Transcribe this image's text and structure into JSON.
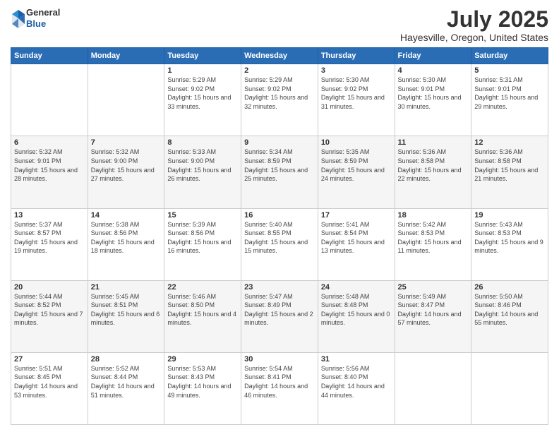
{
  "header": {
    "logo": {
      "line1": "General",
      "line2": "Blue"
    },
    "title": "July 2025",
    "location": "Hayesville, Oregon, United States"
  },
  "days_of_week": [
    "Sunday",
    "Monday",
    "Tuesday",
    "Wednesday",
    "Thursday",
    "Friday",
    "Saturday"
  ],
  "weeks": [
    [
      {
        "day": "",
        "data": ""
      },
      {
        "day": "",
        "data": ""
      },
      {
        "day": "1",
        "sunrise": "5:29 AM",
        "sunset": "9:02 PM",
        "daylight": "15 hours and 33 minutes."
      },
      {
        "day": "2",
        "sunrise": "5:29 AM",
        "sunset": "9:02 PM",
        "daylight": "15 hours and 32 minutes."
      },
      {
        "day": "3",
        "sunrise": "5:30 AM",
        "sunset": "9:02 PM",
        "daylight": "15 hours and 31 minutes."
      },
      {
        "day": "4",
        "sunrise": "5:30 AM",
        "sunset": "9:01 PM",
        "daylight": "15 hours and 30 minutes."
      },
      {
        "day": "5",
        "sunrise": "5:31 AM",
        "sunset": "9:01 PM",
        "daylight": "15 hours and 29 minutes."
      }
    ],
    [
      {
        "day": "6",
        "sunrise": "5:32 AM",
        "sunset": "9:01 PM",
        "daylight": "15 hours and 28 minutes."
      },
      {
        "day": "7",
        "sunrise": "5:32 AM",
        "sunset": "9:00 PM",
        "daylight": "15 hours and 27 minutes."
      },
      {
        "day": "8",
        "sunrise": "5:33 AM",
        "sunset": "9:00 PM",
        "daylight": "15 hours and 26 minutes."
      },
      {
        "day": "9",
        "sunrise": "5:34 AM",
        "sunset": "8:59 PM",
        "daylight": "15 hours and 25 minutes."
      },
      {
        "day": "10",
        "sunrise": "5:35 AM",
        "sunset": "8:59 PM",
        "daylight": "15 hours and 24 minutes."
      },
      {
        "day": "11",
        "sunrise": "5:36 AM",
        "sunset": "8:58 PM",
        "daylight": "15 hours and 22 minutes."
      },
      {
        "day": "12",
        "sunrise": "5:36 AM",
        "sunset": "8:58 PM",
        "daylight": "15 hours and 21 minutes."
      }
    ],
    [
      {
        "day": "13",
        "sunrise": "5:37 AM",
        "sunset": "8:57 PM",
        "daylight": "15 hours and 19 minutes."
      },
      {
        "day": "14",
        "sunrise": "5:38 AM",
        "sunset": "8:56 PM",
        "daylight": "15 hours and 18 minutes."
      },
      {
        "day": "15",
        "sunrise": "5:39 AM",
        "sunset": "8:56 PM",
        "daylight": "15 hours and 16 minutes."
      },
      {
        "day": "16",
        "sunrise": "5:40 AM",
        "sunset": "8:55 PM",
        "daylight": "15 hours and 15 minutes."
      },
      {
        "day": "17",
        "sunrise": "5:41 AM",
        "sunset": "8:54 PM",
        "daylight": "15 hours and 13 minutes."
      },
      {
        "day": "18",
        "sunrise": "5:42 AM",
        "sunset": "8:53 PM",
        "daylight": "15 hours and 11 minutes."
      },
      {
        "day": "19",
        "sunrise": "5:43 AM",
        "sunset": "8:53 PM",
        "daylight": "15 hours and 9 minutes."
      }
    ],
    [
      {
        "day": "20",
        "sunrise": "5:44 AM",
        "sunset": "8:52 PM",
        "daylight": "15 hours and 7 minutes."
      },
      {
        "day": "21",
        "sunrise": "5:45 AM",
        "sunset": "8:51 PM",
        "daylight": "15 hours and 6 minutes."
      },
      {
        "day": "22",
        "sunrise": "5:46 AM",
        "sunset": "8:50 PM",
        "daylight": "15 hours and 4 minutes."
      },
      {
        "day": "23",
        "sunrise": "5:47 AM",
        "sunset": "8:49 PM",
        "daylight": "15 hours and 2 minutes."
      },
      {
        "day": "24",
        "sunrise": "5:48 AM",
        "sunset": "8:48 PM",
        "daylight": "15 hours and 0 minutes."
      },
      {
        "day": "25",
        "sunrise": "5:49 AM",
        "sunset": "8:47 PM",
        "daylight": "14 hours and 57 minutes."
      },
      {
        "day": "26",
        "sunrise": "5:50 AM",
        "sunset": "8:46 PM",
        "daylight": "14 hours and 55 minutes."
      }
    ],
    [
      {
        "day": "27",
        "sunrise": "5:51 AM",
        "sunset": "8:45 PM",
        "daylight": "14 hours and 53 minutes."
      },
      {
        "day": "28",
        "sunrise": "5:52 AM",
        "sunset": "8:44 PM",
        "daylight": "14 hours and 51 minutes."
      },
      {
        "day": "29",
        "sunrise": "5:53 AM",
        "sunset": "8:43 PM",
        "daylight": "14 hours and 49 minutes."
      },
      {
        "day": "30",
        "sunrise": "5:54 AM",
        "sunset": "8:41 PM",
        "daylight": "14 hours and 46 minutes."
      },
      {
        "day": "31",
        "sunrise": "5:56 AM",
        "sunset": "8:40 PM",
        "daylight": "14 hours and 44 minutes."
      },
      {
        "day": "",
        "data": ""
      },
      {
        "day": "",
        "data": ""
      }
    ]
  ]
}
